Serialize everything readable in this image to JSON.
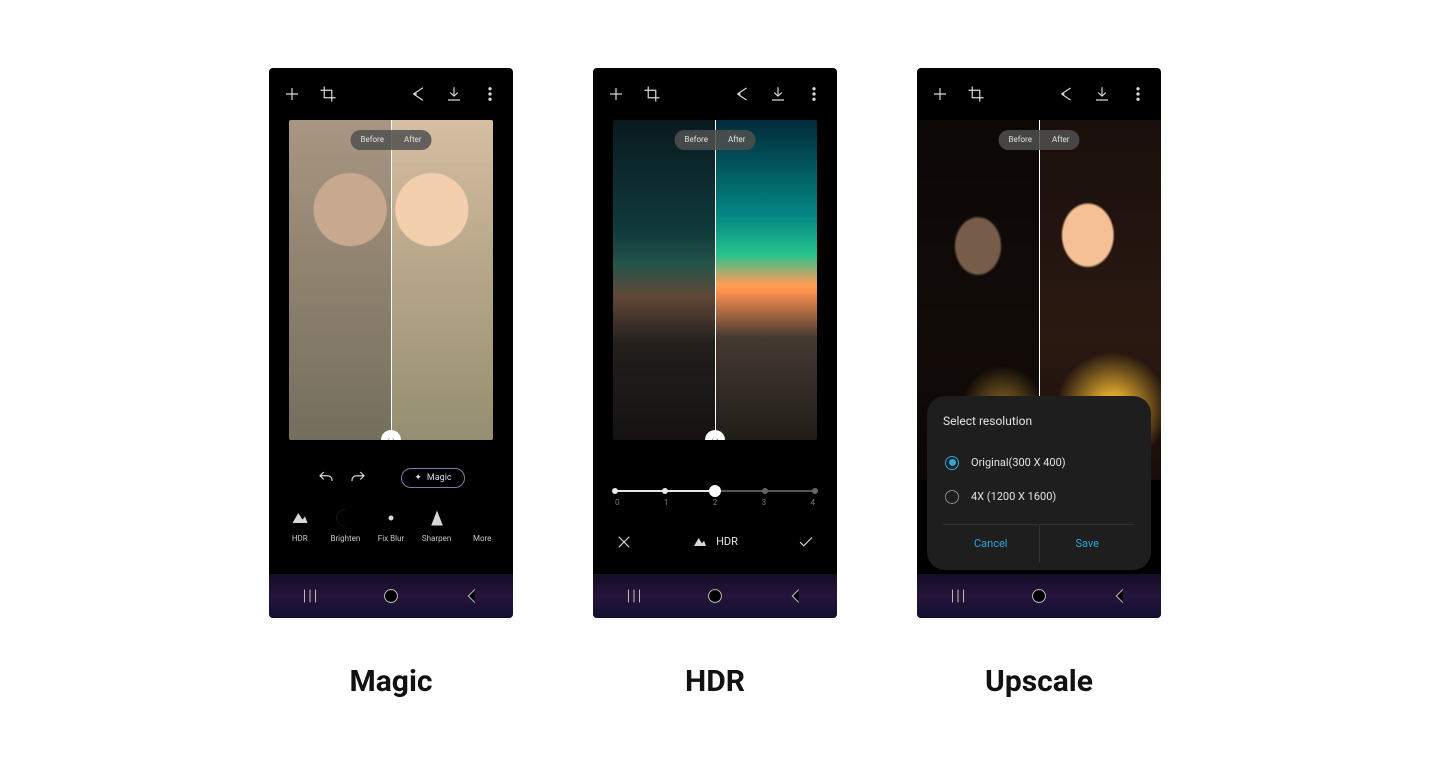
{
  "compare": {
    "before": "Before",
    "after": "After"
  },
  "screens": [
    {
      "caption": "Magic",
      "magic_chip": "Magic",
      "tools": [
        {
          "label": "HDR"
        },
        {
          "label": "Brighten"
        },
        {
          "label": "Fix Blur"
        },
        {
          "label": "Sharpen"
        },
        {
          "label": "More"
        }
      ]
    },
    {
      "caption": "HDR",
      "hdr_label": "HDR",
      "slider": {
        "ticks": [
          "0",
          "1",
          "2",
          "3",
          "4"
        ],
        "value": 2
      }
    },
    {
      "caption": "Upscale",
      "sheet": {
        "title": "Select resolution",
        "options": [
          {
            "label": "Original(300 X 400)",
            "selected": true
          },
          {
            "label": "4X (1200 X 1600)",
            "selected": false
          }
        ],
        "cancel": "Cancel",
        "save": "Save"
      }
    }
  ]
}
